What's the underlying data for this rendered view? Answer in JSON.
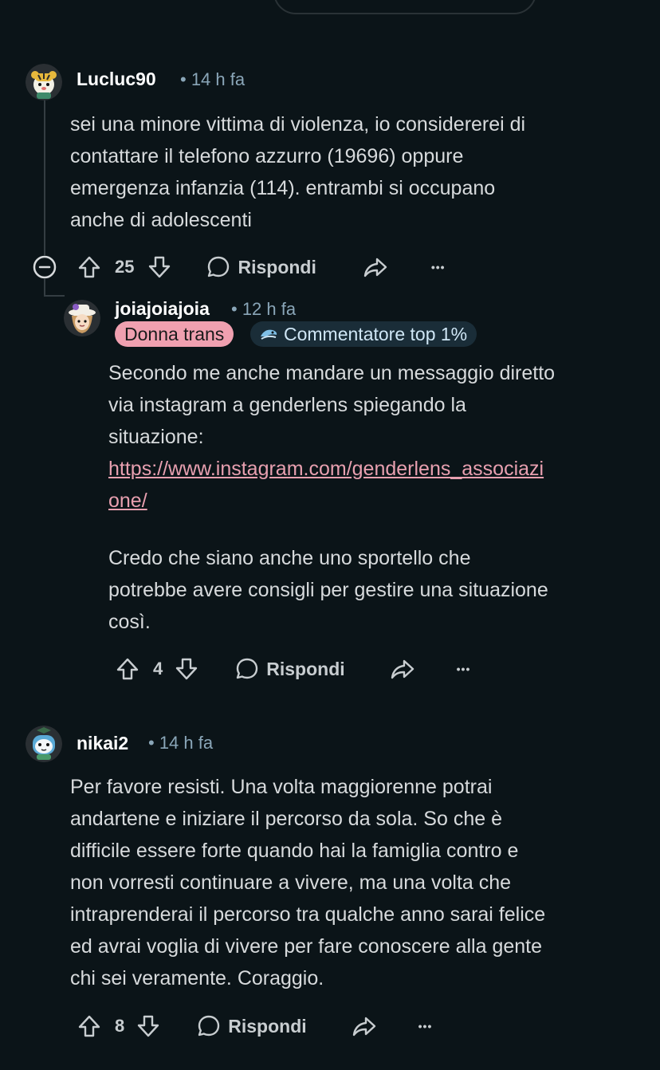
{
  "comments": {
    "c1": {
      "username": "Lucluc90",
      "time": "• 14 h fa",
      "body": [
        "sei una minore vittima di violenza, io considererei di",
        "contattare il telefono azzurro (19696) oppure",
        "emergenza infanzia (114). entrambi si occupano",
        "anche di adolescenti"
      ],
      "votes": "25",
      "reply_label": "Rispondi",
      "more": "•••"
    },
    "c2": {
      "username": "joiajoiajoia",
      "time": "• 12 h fa",
      "flair": "Donna trans",
      "badge": "Commentatore top 1%",
      "body_p1": [
        "Secondo me anche mandare un messaggio diretto",
        "via instagram a genderlens spiegando la",
        "situazione:"
      ],
      "link": [
        "https://www.instagram.com/genderlens_associazi",
        "one/"
      ],
      "body_p2": [
        "Credo che siano anche uno sportello che",
        "potrebbe avere consigli per gestire una situazione",
        "così."
      ],
      "votes": "4",
      "reply_label": "Rispondi",
      "more": "•••"
    },
    "c3": {
      "username": "nikai2",
      "time": "• 14 h fa",
      "body": [
        "Per favore resisti. Una volta maggiorenne potrai",
        "andartene e iniziare il percorso da sola. So che è",
        "difficile essere forte quando hai la famiglia contro e",
        "non vorresti continuare a vivere, ma una volta che",
        "intraprenderai il percorso tra qualche anno sarai felice",
        "ed avrai voglia di vivere per fare conoscere alla gente",
        "chi sei veramente. Coraggio."
      ],
      "votes": "8",
      "reply_label": "Rispondi",
      "more": "•••"
    }
  },
  "icons": {
    "upvote": "upvote-icon",
    "downvote": "downvote-icon",
    "reply": "reply-bubble-icon",
    "share": "share-icon",
    "collapse": "collapse-icon"
  },
  "colors": {
    "background": "#0b1418",
    "text": "#d7dadc",
    "link": "#e8a0b0",
    "flair_bg": "#f0a0b0",
    "time": "#8aa6b8"
  }
}
